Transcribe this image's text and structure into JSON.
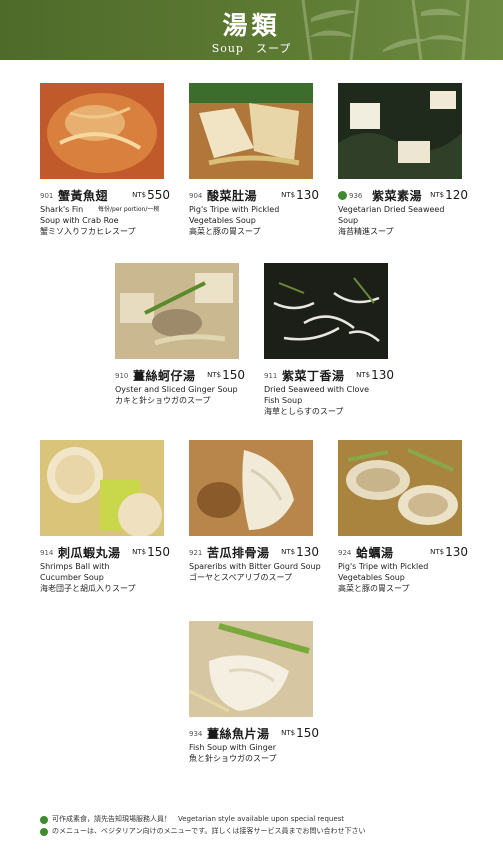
{
  "header": {
    "title": "湯類",
    "subtitle": "Soup　スープ"
  },
  "currency": "NT$",
  "items": [
    {
      "code": "901",
      "zh": "蟹黃魚翅",
      "price": "550",
      "en1": "Shark's Fin",
      "portion": "每份/per portion/一椀",
      "en2": "Soup with Crab Roe",
      "jp": "蟹ミソ入りフカヒレスープ",
      "veg": false
    },
    {
      "code": "904",
      "zh": "酸菜肚湯",
      "price": "130",
      "en1": "Pig's Tripe with Pickled",
      "en2": "Vegetables Soup",
      "jp": "高菜と豚の胃スープ",
      "veg": false
    },
    {
      "code": "936",
      "zh": "紫菜素湯",
      "price": "120",
      "en1": "Vegetarian Dried Seaweed",
      "en2": "Soup",
      "jp": "海苔精進スープ",
      "veg": true
    },
    {
      "code": "910",
      "zh": "薑絲蚵仔湯",
      "price": "150",
      "en1": "Oyster and Sliced Ginger Soup",
      "en2": "",
      "jp": "カキと針ショウガのスープ",
      "veg": false
    },
    {
      "code": "911",
      "zh": "紫菜丁香湯",
      "price": "130",
      "en1": "Dried Seaweed with Clove",
      "en2": "Fish Soup",
      "jp": "海草としらすのスープ",
      "veg": false
    },
    {
      "code": "914",
      "zh": "刺瓜蝦丸湯",
      "price": "150",
      "en1": "Shrimps Ball with",
      "en2": "Cucumber Soup",
      "jp": "海老団子と胡瓜入りスープ",
      "veg": false
    },
    {
      "code": "921",
      "zh": "苦瓜排骨湯",
      "price": "130",
      "en1": "Spareribs with Bitter Gourd Soup",
      "en2": "",
      "jp": "ゴーヤとスペアリブのスープ",
      "veg": false
    },
    {
      "code": "924",
      "zh": "蛤蠣湯",
      "price": "130",
      "en1": "Pig's Tripe with Pickled",
      "en2": "Vegetables Soup",
      "jp": "高菜と豚の胃スープ",
      "veg": false
    },
    {
      "code": "934",
      "zh": "薑絲魚片湯",
      "price": "150",
      "en1": "Fish Soup with Ginger",
      "en2": "",
      "jp": "魚と針ショウガのスープ",
      "veg": false
    }
  ],
  "footer": {
    "note1": "可作成素食，請先告知現場服務人員！　Vegetarian style available upon special request",
    "note2": "のメニューは、ベジタリアン向けのメニューです。詳しくは接客サービス員までお問い合わせ下さい"
  },
  "colors": {
    "header_green": "#5d7a33",
    "veg_dot": "#3e8a2f"
  }
}
